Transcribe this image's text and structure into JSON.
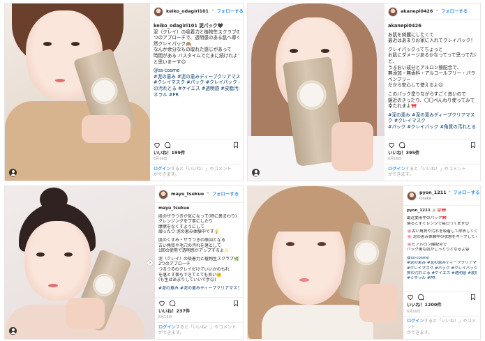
{
  "accent": "#3897f0",
  "posts": [
    {
      "username": "keiko_odagiri101",
      "follow": "フォローする",
      "subtitle": "",
      "caption_lines": [
        {
          "text": "keiko_odagiri101 泥パック🖤",
          "kind": "user"
        },
        {
          "text": "泥（クレイ）の吸着力と植物生スクラブの2",
          "kind": "text"
        },
        {
          "text": "つのアプローチで、透明感のある肌へ導く天",
          "kind": "text"
        },
        {
          "text": "然クレイパック🙈",
          "kind": "text"
        },
        {
          "text": "なんか余分なもの取れた感じがあって",
          "kind": "text"
        },
        {
          "text": "時間がある バスタイムでたまに続けれよう",
          "kind": "text"
        },
        {
          "text": "と思いまーす😊",
          "kind": "text"
        },
        {
          "text": "",
          "kind": "gap"
        },
        {
          "text": "@ss-cosme",
          "kind": "tag"
        },
        {
          "text": "#泥の恵み #泥の恵みディープクリアマスク",
          "kind": "tag"
        },
        {
          "text": "#クレイマスク #パック #クレイパック #角質",
          "kind": "tag"
        },
        {
          "text": "の汚れとる #ケイエス #透明感 #皮脂汚れ #ミ",
          "kind": "tag"
        },
        {
          "text": "ネラル #PR",
          "kind": "tag"
        }
      ],
      "likes": "いいね！199件",
      "date": "6月16日",
      "login_link": "ログイン",
      "login_text": "すると「いいね！」やコメント",
      "login_more": "ができます。"
    },
    {
      "username": "akanepi0426",
      "follow": "フォローする",
      "subtitle": "",
      "caption_lines": [
        {
          "text": "akanepi0426",
          "kind": "user"
        },
        {
          "text": "",
          "kind": "gap"
        },
        {
          "text": "お肌を綺麗にしたくて",
          "kind": "text"
        },
        {
          "text": "最近はあまりお家に入れてクレイパック！",
          "kind": "text"
        },
        {
          "text": "",
          "kind": "gap"
        },
        {
          "text": "クレイパックってちょっと",
          "kind": "text"
        },
        {
          "text": "お肌にダメージあるかなってって思ってたけ",
          "kind": "text"
        },
        {
          "text": "ど、",
          "kind": "text"
        },
        {
          "text": "うるおい成分とアルロン酸配合で、",
          "kind": "text"
        },
        {
          "text": "無添加・無香料・アルコールフリー・パラ",
          "kind": "text"
        },
        {
          "text": "ベンフリー",
          "kind": "text"
        },
        {
          "text": "だから安心して使えるよ😊",
          "kind": "text"
        },
        {
          "text": "",
          "kind": "gap"
        },
        {
          "text": "このパック塗りながらすごく良いので",
          "kind": "text"
        },
        {
          "text": "鏡近のきったり、〇〇ペんわり使ってみて",
          "kind": "text"
        },
        {
          "text": "幸たれまよ🎀",
          "kind": "text"
        },
        {
          "text": "",
          "kind": "gap"
        },
        {
          "text": "#泥の恵み #泥の恵みディープクリアマス",
          "kind": "tag"
        },
        {
          "text": "ク #クレイマスク",
          "kind": "tag"
        },
        {
          "text": "#パック #クレイパック #角質の汚れとる",
          "kind": "tag"
        }
      ],
      "likes": "いいね！395件",
      "date": "6月16日",
      "login_link": "ログイン",
      "login_text": "すると「いいね！」やコメント",
      "login_more": "ができます。"
    },
    {
      "username": "mayu_tsukue",
      "follow": "フォローする",
      "subtitle": "",
      "caption_lines": [
        {
          "text": "mayu_tsukue",
          "kind": "user"
        },
        {
          "text": "",
          "kind": "gap"
        },
        {
          "text": "肌のザラつきが気になって(特に鼻まわり)",
          "kind": "text"
        },
        {
          "text": "クレンジングを丁寧にしたり",
          "kind": "text"
        },
        {
          "text": "摩擦をなくすようにして",
          "kind": "text"
        },
        {
          "text": "頑ったつ 泥の恵み体験中です💡",
          "kind": "text"
        },
        {
          "text": "",
          "kind": "gap"
        },
        {
          "text": "肌のくすみ・ザラつきの原因となる",
          "kind": "text"
        },
        {
          "text": "古い角質や毛穴の汚れを落として",
          "kind": "text"
        },
        {
          "text": "1回の使用で透明感がアップするよ✨",
          "kind": "text"
        },
        {
          "text": "",
          "kind": "gap"
        },
        {
          "text": "泥（クレイ）の吸着力と植物生スクラブ🌿",
          "kind": "text"
        },
        {
          "text": "2つのアプローチ",
          "kind": "text"
        },
        {
          "text": "つるつるのクレイだけでいいかのもれ",
          "kind": "text"
        },
        {
          "text": "を落とす事もできてとても良い🙂",
          "kind": "text"
        },
        {
          "text": "(も生はあまりしていいで手😊)",
          "kind": "text"
        },
        {
          "text": "",
          "kind": "gap"
        },
        {
          "text": "#泥の恵み #泥の恵みディープクリアマスク",
          "kind": "tag"
        }
      ],
      "likes": "いいね！237件",
      "date": "6月16日",
      "login_link": "ログイン",
      "login_text": "すると「いいね！」やコメント",
      "login_more": "ができます。"
    },
    {
      "username": "pyon_1211",
      "follow": "フォローする",
      "subtitle": "Osaka",
      "caption_lines": [
        {
          "text": "pyon_1211 🐰💝🎀",
          "kind": "user"
        },
        {
          "text": "",
          "kind": "gap"
        },
        {
          "text": "最近愛用中のパック🎀",
          "kind": "text"
        },
        {
          "text": "寝るとすぐレンジで毎日ってます😌",
          "kind": "text"
        },
        {
          "text": "",
          "kind": "gap"
        },
        {
          "text": "🌸古い角質や汚れを吸着して除去してくれるの",
          "kind": "text"
        },
        {
          "text": "🌸 泥の恵み体験中の状態をキープしてくれます",
          "kind": "text"
        },
        {
          "text": "",
          "kind": "gap"
        },
        {
          "text": "🌸ヒアルロン酸配合で",
          "kind": "text"
        },
        {
          "text": "パック後も肌がしっとりとなるよ😆",
          "kind": "text"
        },
        {
          "text": "",
          "kind": "gap"
        },
        {
          "text": "@ss-cosme",
          "kind": "tag"
        },
        {
          "text": "#泥の恵み #泥の恵みディープクリアマスク",
          "kind": "tag"
        },
        {
          "text": "#クレイマスク #パック #クレイパック #角",
          "kind": "tag"
        },
        {
          "text": "質の汚れとる #ケイエス #透明感 #皮脂汚れ",
          "kind": "tag"
        },
        {
          "text": "#ミネラル #PR",
          "kind": "tag"
        }
      ],
      "likes": "いいね！1200件",
      "date": "6月16日",
      "login_link": "ログイン",
      "login_text": "すると「いいね！」やコメント",
      "login_more": "ができます。"
    }
  ]
}
